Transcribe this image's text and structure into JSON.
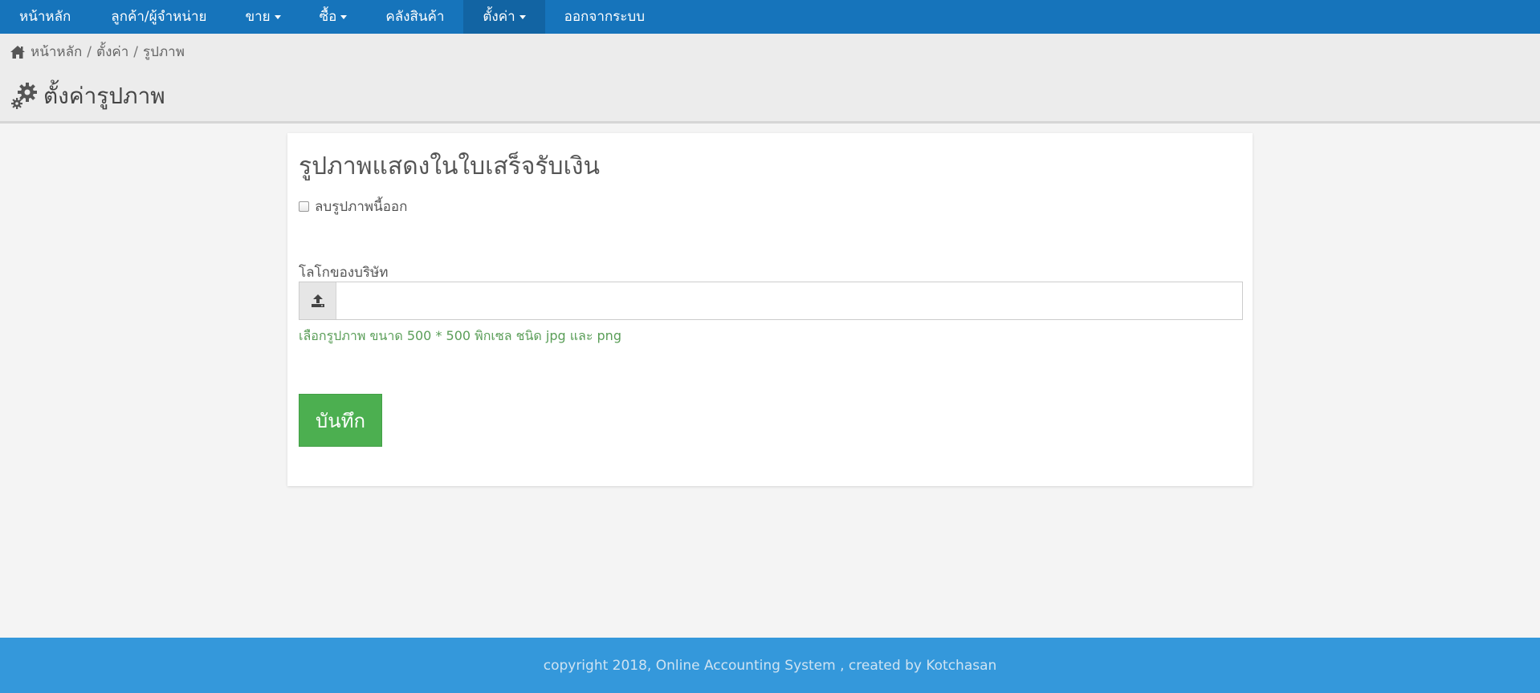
{
  "nav": {
    "items": [
      {
        "label": "หน้าหลัก",
        "dropdown": false,
        "active": false
      },
      {
        "label": "ลูกค้า/ผู้จำหน่าย",
        "dropdown": false,
        "active": false
      },
      {
        "label": "ขาย",
        "dropdown": true,
        "active": false
      },
      {
        "label": "ซื้อ",
        "dropdown": true,
        "active": false
      },
      {
        "label": "คลังสินค้า",
        "dropdown": false,
        "active": false
      },
      {
        "label": "ตั้งค่า",
        "dropdown": true,
        "active": true
      },
      {
        "label": "ออกจากระบบ",
        "dropdown": false,
        "active": false
      }
    ]
  },
  "breadcrumb": {
    "home": "หน้าหลัก",
    "settings": "ตั้งค่า",
    "current": "รูปภาพ",
    "separator": "/"
  },
  "page": {
    "title": "ตั้งค่ารูปภาพ"
  },
  "form": {
    "heading": "รูปภาพแสดงในใบเสร็จรับเงิน",
    "delete_checkbox_label": "ลบรูปภาพนี้ออก",
    "delete_checked": false,
    "logo_label": "โลโกของบริษัท",
    "logo_value": "",
    "help_text": "เลือกรูปภาพ ขนาด 500 * 500 พิกเซล ชนิด jpg และ png",
    "save_label": "บันทึก"
  },
  "footer": {
    "text": "copyright 2018, Online Accounting System , created by Kotchasan"
  },
  "colors": {
    "nav_bg": "#1674bb",
    "nav_active_bg": "#1264a3",
    "footer_bg": "#3498db",
    "save_button": "#4caf50",
    "help_text": "#5a9e58"
  },
  "icons": {
    "breadcrumb_home": "home-icon",
    "title": "gears-icon",
    "file_button": "upload-icon"
  }
}
